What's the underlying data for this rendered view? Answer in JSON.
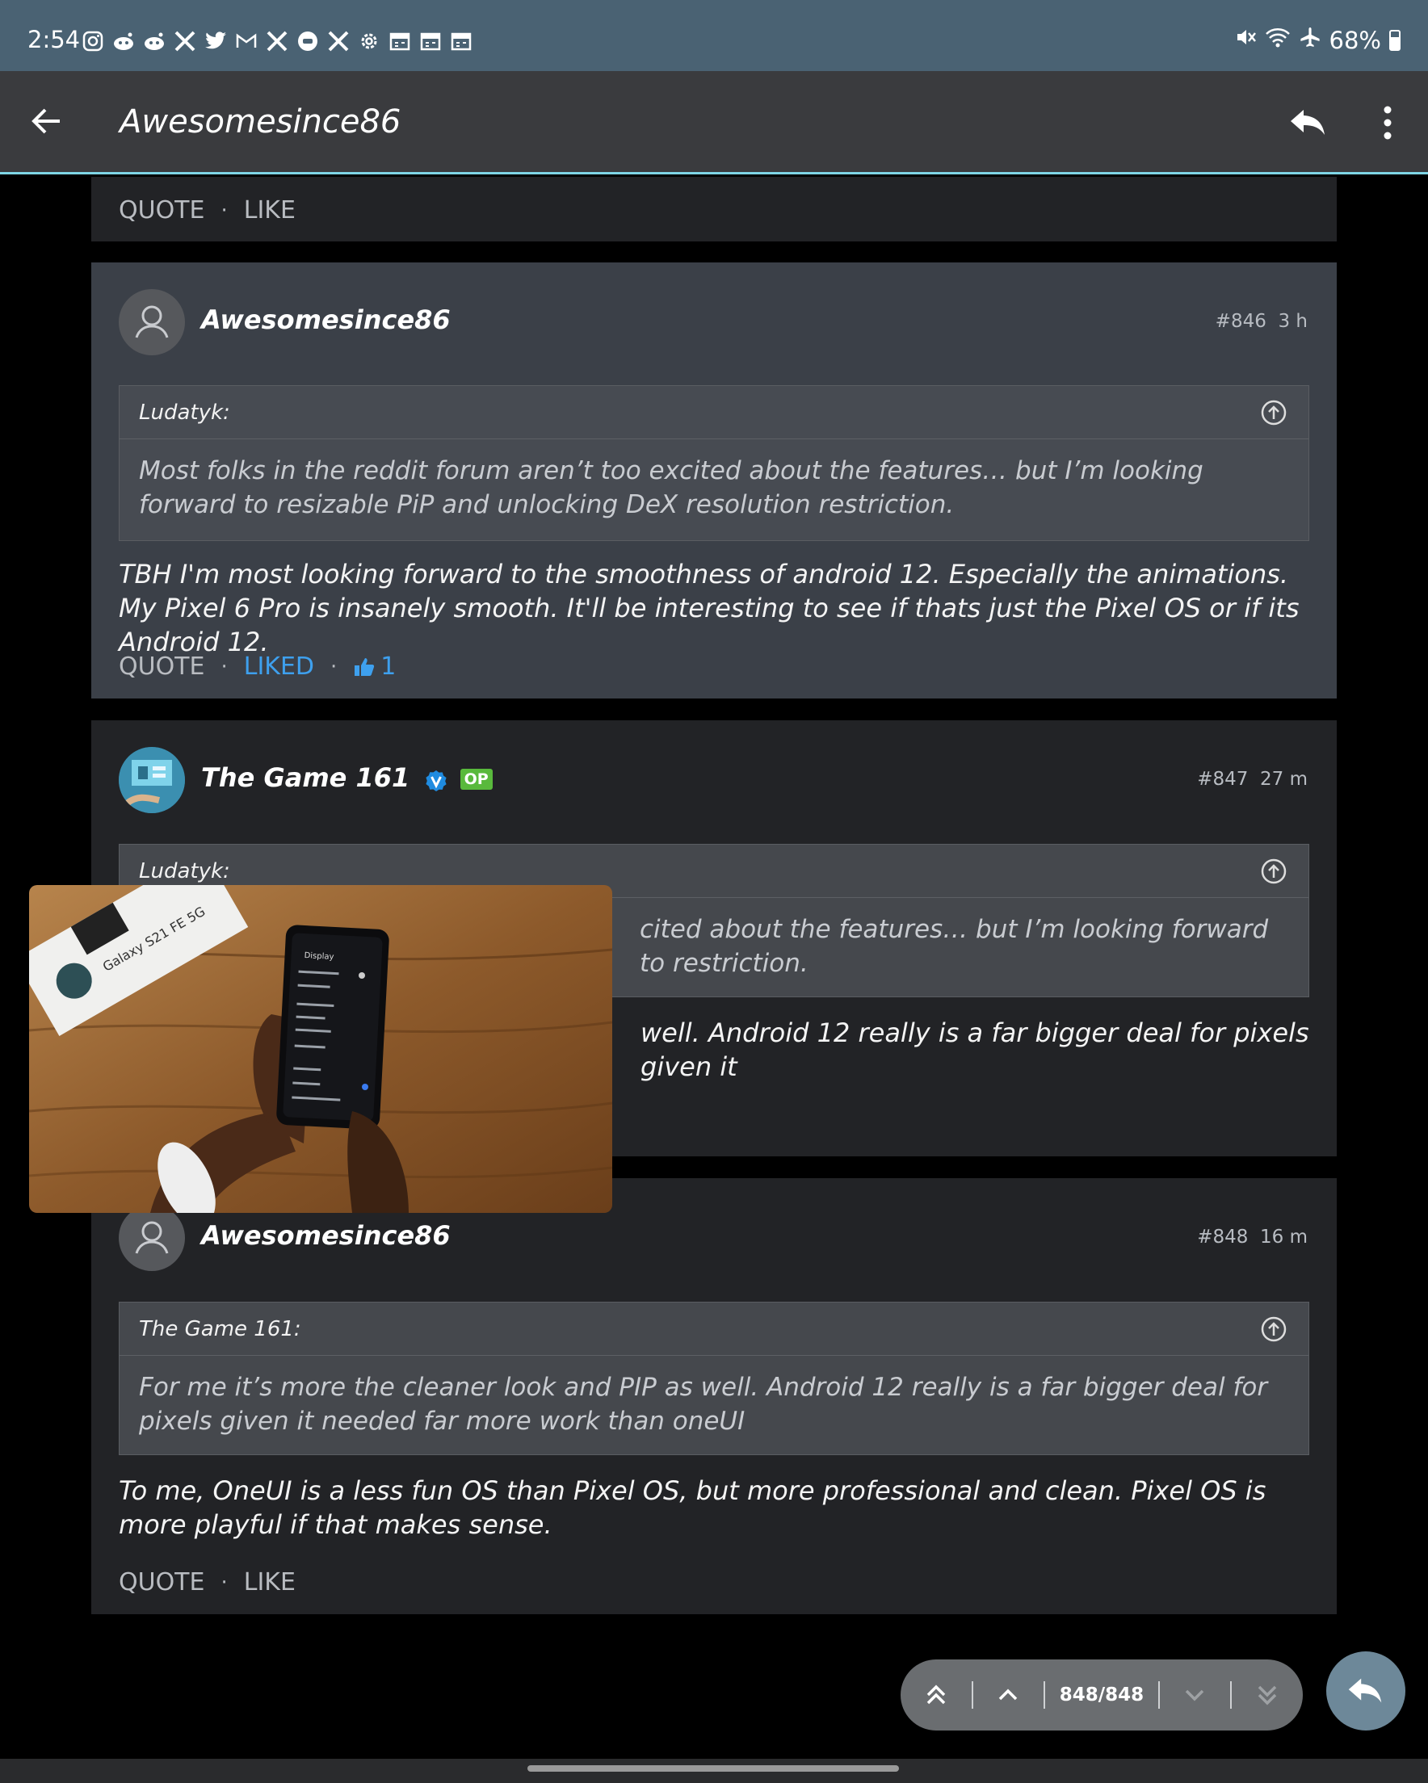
{
  "status_bar": {
    "time": "2:54",
    "battery": "68%"
  },
  "app_bar": {
    "title": "Awesomesince86"
  },
  "prev_post": {
    "quote_label": "QUOTE",
    "like_label": "LIKE",
    "sep": "·"
  },
  "posts": [
    {
      "author": "Awesomesince86",
      "number": "#846",
      "time": "3 h",
      "quote_author": "Ludatyk:",
      "quote_text": "Most folks in the reddit forum aren’t too excited about the features… but I’m looking forward to resizable PiP and unlocking DeX resolution restriction.",
      "body": "TBH I'm most looking forward to the smoothness of android 12. Especially the animations. My Pixel 6 Pro is insanely smooth. It'll be interesting to see if thats just the Pixel OS or if its Android 12.",
      "quote_label": "QUOTE",
      "like_label": "LIKED",
      "like_count": "1",
      "sep": "·"
    },
    {
      "author": "The Game 161",
      "op_badge": "OP",
      "number": "#847",
      "time": "27 m",
      "quote_author": "Ludatyk:",
      "quote_text_visible": "cited about the features… but I’m looking forward to restriction.",
      "body_visible": "well. Android 12 really is a far bigger deal for pixels given it"
    },
    {
      "author": "Awesomesince86",
      "number": "#848",
      "time": "16 m",
      "quote_author": "The Game 161:",
      "quote_text": "For me it’s more the cleaner look and PIP as well. Android 12 really is a far bigger deal for pixels given it needed far more work than oneUI",
      "body": "To me, OneUI is a less fun OS than Pixel OS, but more professional and clean. Pixel OS is more playful if that makes sense.",
      "quote_label": "QUOTE",
      "like_label": "LIKE",
      "sep": "·"
    }
  ],
  "pip_video": {
    "box_label": "Galaxy S21 FE 5G",
    "screen_title": "Display"
  },
  "nav": {
    "page_indicator": "848/848"
  },
  "colors": {
    "accent": "#3ea0ee",
    "statusbar": "#4a6273",
    "appbar": "#3a3b3e",
    "op_badge": "#59b93c"
  }
}
